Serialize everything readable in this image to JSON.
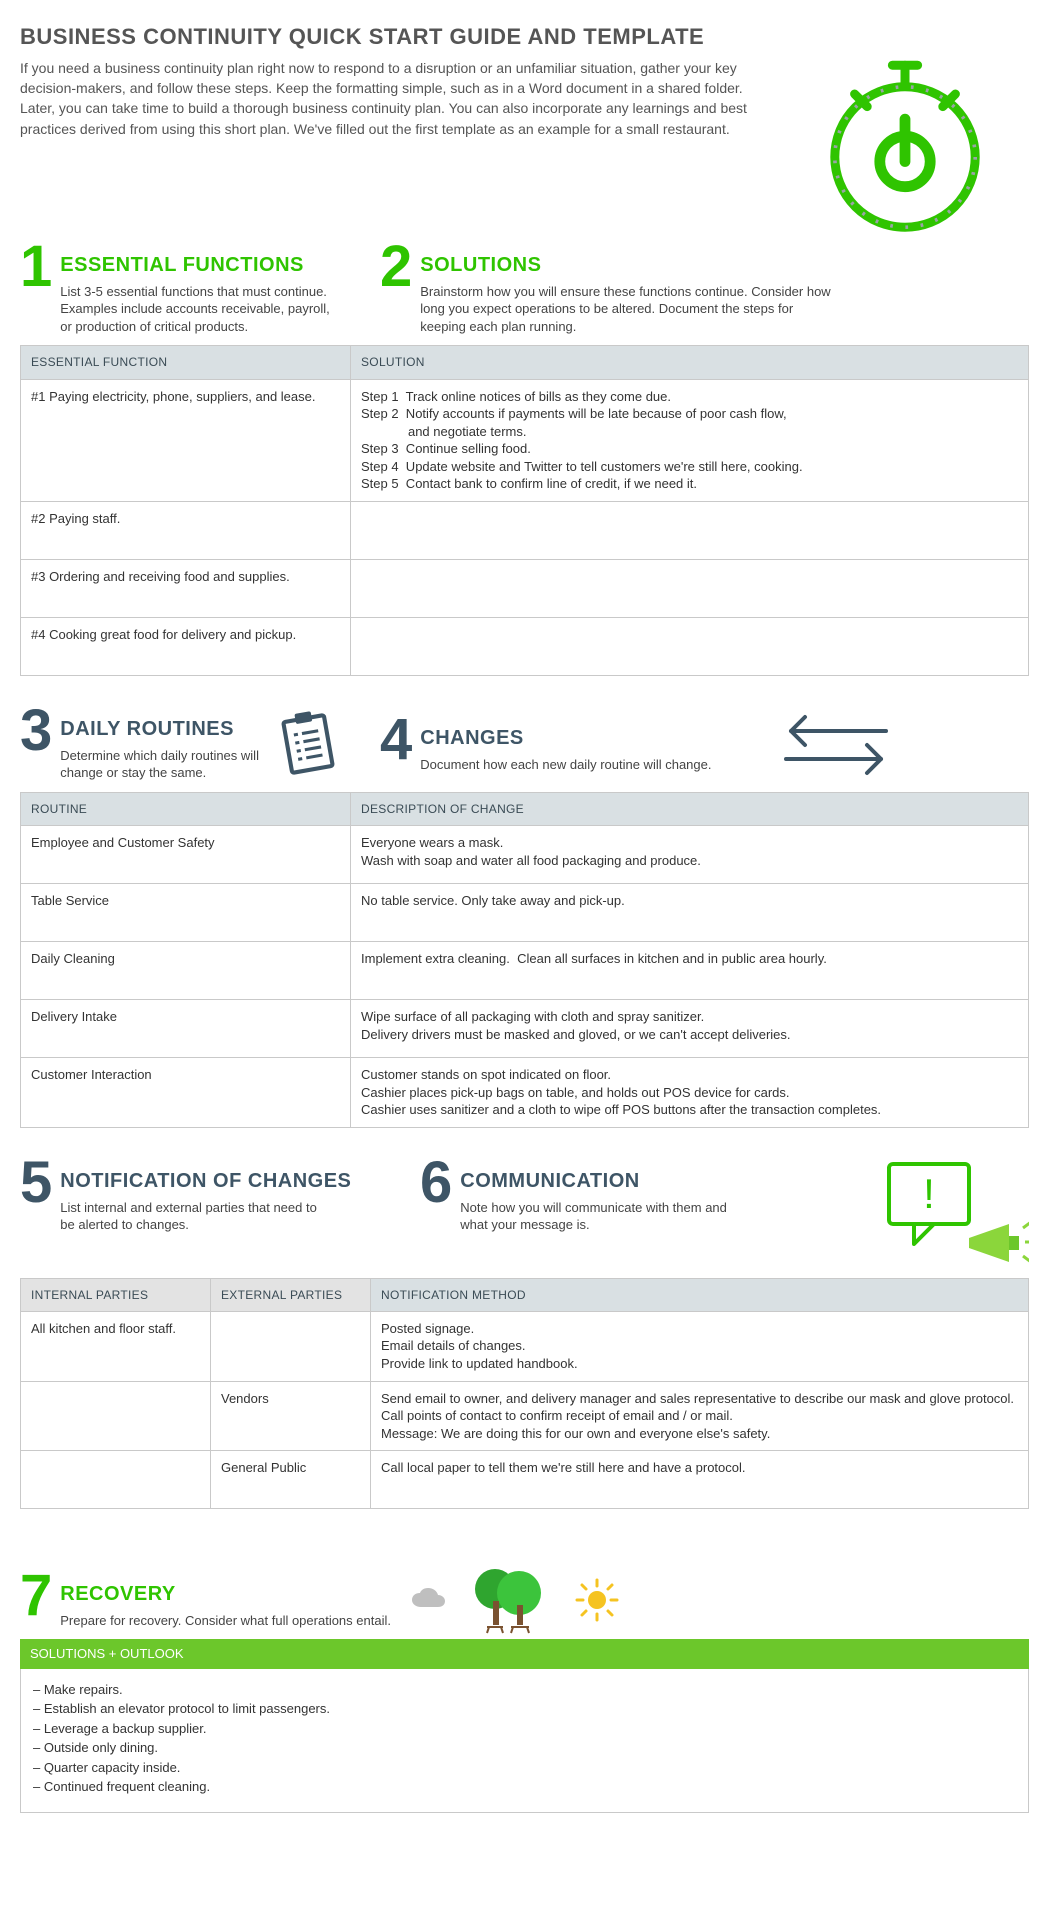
{
  "page_title": "BUSINESS CONTINUITY QUICK START GUIDE AND TEMPLATE",
  "intro": "If you need a business continuity plan right now to respond to a disruption or an unfamiliar situation, gather your key decision-makers, and follow these steps. Keep the formatting simple, such as in a Word document in a shared folder. Later, you can take time to build a thorough business continuity plan. You can also incorporate any learnings and best practices derived from using this short plan. We've filled out the first template as an example for a small restaurant.",
  "sec1": {
    "num": "1",
    "title": "ESSENTIAL FUNCTIONS",
    "desc": "List 3-5 essential functions that must continue. Examples include accounts receivable, payroll, or production of critical products."
  },
  "sec2": {
    "num": "2",
    "title": "SOLUTIONS",
    "desc": "Brainstorm how you will ensure these functions continue. Consider how long you expect operations to be altered. Document the steps for keeping each plan running."
  },
  "table1": {
    "head_a": "ESSENTIAL FUNCTION",
    "head_b": "SOLUTION",
    "rows": [
      {
        "a": "#1 Paying electricity, phone, suppliers, and lease.",
        "b": "Step 1  Track online notices of bills as they come due.\nStep 2  Notify accounts if payments will be late because of poor cash flow,\n             and negotiate terms.\nStep 3  Continue selling food.\nStep 4  Update website and Twitter to tell customers we're still here, cooking.\nStep 5  Contact bank to confirm line of credit, if we need it."
      },
      {
        "a": "#2 Paying staff.",
        "b": ""
      },
      {
        "a": "#3 Ordering and receiving food and supplies.",
        "b": ""
      },
      {
        "a": "#4 Cooking great food for delivery and pickup.",
        "b": ""
      }
    ]
  },
  "sec3": {
    "num": "3",
    "title": "DAILY ROUTINES",
    "desc": "Determine which daily routines will change or stay the same."
  },
  "sec4": {
    "num": "4",
    "title": "CHANGES",
    "desc": "Document how each new daily routine will change."
  },
  "table2": {
    "head_a": "ROUTINE",
    "head_b": "DESCRIPTION OF CHANGE",
    "rows": [
      {
        "a": "Employee and Customer Safety",
        "b": "Everyone wears a mask.\nWash with soap and water all food packaging and produce."
      },
      {
        "a": "Table Service",
        "b": "No table service. Only take away and pick-up."
      },
      {
        "a": "Daily Cleaning",
        "b": "Implement extra cleaning.  Clean all surfaces in kitchen and in public area hourly."
      },
      {
        "a": "Delivery Intake",
        "b": "Wipe surface of all packaging with cloth and spray sanitizer.\nDelivery drivers must be masked and gloved, or we can't accept deliveries."
      },
      {
        "a": "Customer Interaction",
        "b": "Customer stands on spot indicated on floor.\nCashier places pick-up bags on table, and holds out POS device for cards.\nCashier uses sanitizer and a cloth to wipe off POS buttons after the transaction completes."
      }
    ]
  },
  "sec5": {
    "num": "5",
    "title": "NOTIFICATION OF CHANGES",
    "desc": "List internal and external parties that need to be alerted to changes."
  },
  "sec6": {
    "num": "6",
    "title": "COMMUNICATION",
    "desc": "Note how you will communicate with them and what your message is."
  },
  "table3": {
    "head_a": "INTERNAL PARTIES",
    "head_b": "EXTERNAL PARTIES",
    "head_c": "NOTIFICATION METHOD",
    "rows": [
      {
        "a": "All kitchen and floor staff.",
        "b": "",
        "c": "Posted signage.\nEmail details of changes.\nProvide link to updated handbook."
      },
      {
        "a": "",
        "b": "Vendors",
        "c": "Send email to owner, and delivery manager and sales representative to describe our mask and glove protocol.\nCall points of contact to confirm receipt of email and / or mail.\nMessage: We are doing this for our own and everyone else's safety."
      },
      {
        "a": "",
        "b": "General Public",
        "c": "Call local paper to tell them we're still here and have a protocol."
      }
    ]
  },
  "sec7": {
    "num": "7",
    "title": "RECOVERY",
    "desc": "Prepare for recovery. Consider what full operations entail."
  },
  "recovery": {
    "bar": "SOLUTIONS + OUTLOOK",
    "items": [
      "– Make repairs.",
      "– Establish an elevator protocol to limit passengers.",
      "– Leverage a backup supplier.",
      "– Outside only dining.",
      "– Quarter capacity inside.",
      "– Continued frequent cleaning."
    ]
  }
}
